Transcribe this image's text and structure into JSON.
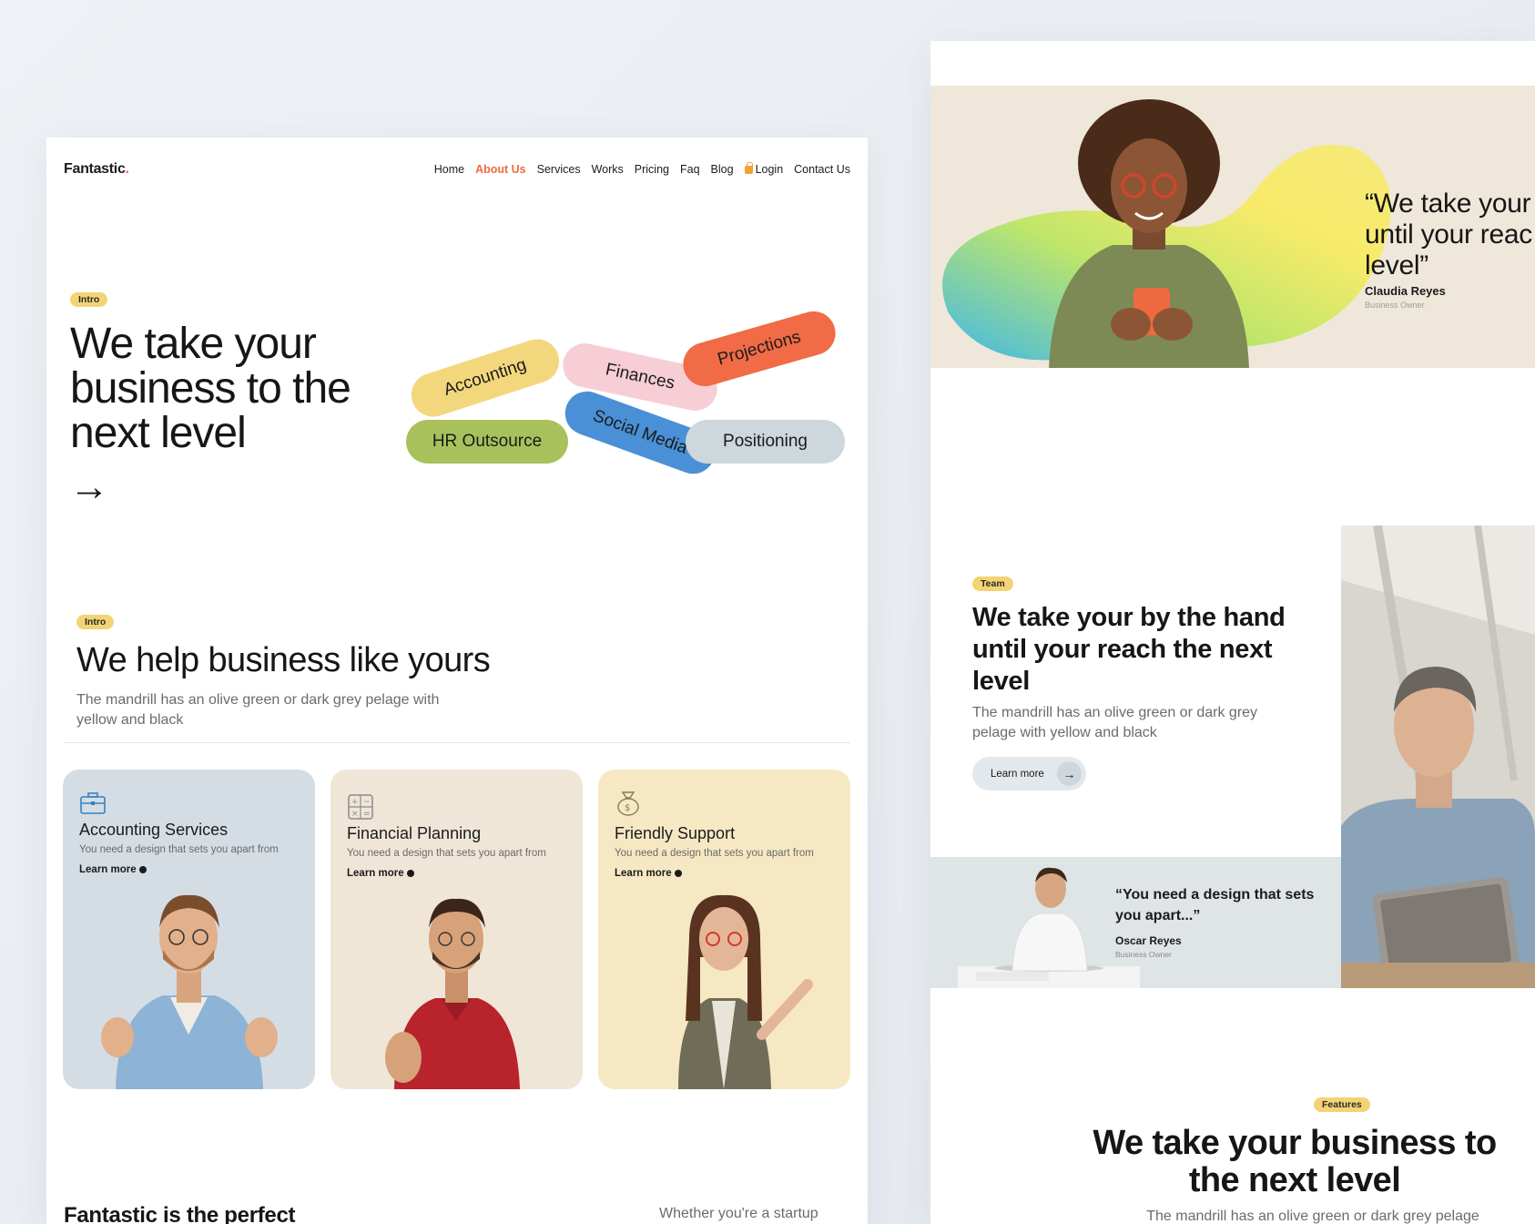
{
  "left": {
    "nav": {
      "logo": "Fantastic",
      "logo_dot": ".",
      "links": [
        "Home",
        "About Us",
        "Services",
        "Works",
        "Pricing",
        "Faq",
        "Blog",
        "Login",
        "Contact Us"
      ],
      "active": "About Us"
    },
    "hero": {
      "tag": "Intro",
      "title": "We take your business to the next level",
      "arrow": "→",
      "tags": [
        "Accounting",
        "Finances",
        "Projections",
        "HR Outsource",
        "Social Media",
        "Positioning"
      ]
    },
    "section2": {
      "tag": "Intro",
      "title": "We help business like yours",
      "desc": "The mandrill has an olive green or dark grey pelage with yellow and black"
    },
    "cards": [
      {
        "title": "Accounting Services",
        "desc": "You need a design that sets you apart from",
        "link": "Learn more",
        "icon": "briefcase-icon",
        "bg": "#d5dde4"
      },
      {
        "title": "Financial Planning",
        "desc": "You need a design that sets you apart from",
        "link": "Learn more",
        "icon": "calculator-icon",
        "bg": "#efe6d7"
      },
      {
        "title": "Friendly Support",
        "desc": "You need a design that sets you apart from",
        "link": "Learn more",
        "icon": "money-bag-icon",
        "bg": "#f6e8c3"
      }
    ],
    "bottom": {
      "title": "Fantastic is the perfect",
      "side": "Whether you're a startup"
    }
  },
  "right": {
    "testimonial": {
      "quote": "“We take your\nuntil your reac\nlevel”",
      "name": "Claudia Reyes",
      "role": "Business Owner"
    },
    "team": {
      "tag": "Team",
      "title": "We take your by the hand until your reach the next level",
      "desc": "The mandrill has an olive green or dark grey pelage with yellow and black",
      "button": "Learn more"
    },
    "quote2": {
      "text": "“You need a design that sets you apart...”",
      "name": "Oscar Reyes",
      "role": "Business Owner"
    },
    "features": {
      "tag": "Features",
      "title": "We take your business to the next level",
      "desc": "The mandrill has an olive green or dark grey pelage"
    }
  },
  "colors": {
    "accent": "#ef6a3e",
    "tag_yellow": "#f3d474",
    "accounting": "#f2d77c",
    "finances": "#f7cdd6",
    "projections": "#f06b46",
    "hr": "#a9c15c",
    "social": "#4a90d6",
    "positioning": "#cdd7dc"
  }
}
